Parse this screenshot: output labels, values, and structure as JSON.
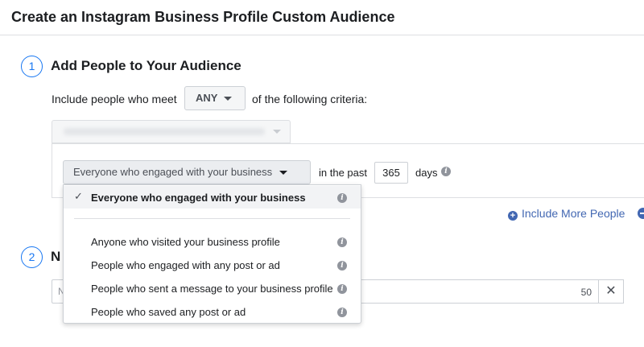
{
  "header": {
    "title": "Create an Instagram Business Profile Custom Audience"
  },
  "step1": {
    "number": "1",
    "title": "Add People to Your Audience",
    "criteria_prefix": "Include people who meet",
    "match_value": "ANY",
    "criteria_suffix": "of the following criteria:",
    "engagement_select": "Everyone who engaged with your business",
    "in_the_past": "in the past",
    "days_value": "365",
    "days_label": "days",
    "include_more": "Include More People"
  },
  "dropdown": {
    "selected": "Everyone who engaged with your business",
    "options": [
      "Anyone who visited your business profile",
      "People who engaged with any post or ad",
      "People who sent a message to your business profile",
      "People who saved any post or ad"
    ]
  },
  "step2": {
    "number": "2",
    "title_visible": "N",
    "name_placeholder": "N",
    "char_count": "50",
    "clear": "✕"
  },
  "icons": {
    "info": "i",
    "check": "✓",
    "plus": "+"
  },
  "colors": {
    "accent": "#1877f2",
    "link": "#4267b2",
    "icon_gray": "#90949c"
  }
}
